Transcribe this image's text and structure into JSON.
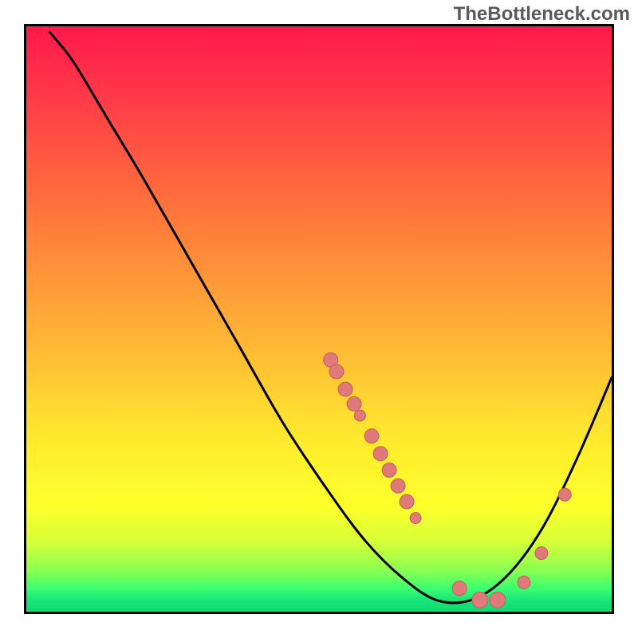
{
  "watermark": "TheBottleneck.com",
  "chart_data": {
    "type": "line",
    "title": "",
    "xlabel": "",
    "ylabel": "",
    "xlim": [
      0,
      100
    ],
    "ylim": [
      0,
      100
    ],
    "grid": false,
    "series": [
      {
        "name": "curve",
        "points": [
          {
            "x": 4,
            "y": 99
          },
          {
            "x": 8,
            "y": 94
          },
          {
            "x": 14,
            "y": 84
          },
          {
            "x": 20,
            "y": 74
          },
          {
            "x": 28,
            "y": 60
          },
          {
            "x": 36,
            "y": 46
          },
          {
            "x": 44,
            "y": 32
          },
          {
            "x": 52,
            "y": 20
          },
          {
            "x": 58,
            "y": 12
          },
          {
            "x": 64,
            "y": 6
          },
          {
            "x": 70,
            "y": 2
          },
          {
            "x": 76,
            "y": 2
          },
          {
            "x": 82,
            "y": 6
          },
          {
            "x": 88,
            "y": 14
          },
          {
            "x": 94,
            "y": 26
          },
          {
            "x": 100,
            "y": 40
          }
        ]
      }
    ],
    "markers": [
      {
        "x": 52,
        "y": 43,
        "r": 9
      },
      {
        "x": 53,
        "y": 41,
        "r": 9
      },
      {
        "x": 54.5,
        "y": 38,
        "r": 9
      },
      {
        "x": 56,
        "y": 35.5,
        "r": 9
      },
      {
        "x": 57,
        "y": 33.5,
        "r": 7
      },
      {
        "x": 59,
        "y": 30,
        "r": 9
      },
      {
        "x": 60.5,
        "y": 27,
        "r": 9
      },
      {
        "x": 62,
        "y": 24.2,
        "r": 9
      },
      {
        "x": 63.5,
        "y": 21.5,
        "r": 9
      },
      {
        "x": 65,
        "y": 18.8,
        "r": 9
      },
      {
        "x": 66.5,
        "y": 16,
        "r": 7
      },
      {
        "x": 74,
        "y": 4,
        "r": 9
      },
      {
        "x": 77.5,
        "y": 2,
        "r": 10
      },
      {
        "x": 80.5,
        "y": 2,
        "r": 10
      },
      {
        "x": 85,
        "y": 5,
        "r": 8
      },
      {
        "x": 88,
        "y": 10,
        "r": 8
      },
      {
        "x": 92,
        "y": 20,
        "r": 8
      }
    ],
    "background": {
      "type": "vertical-gradient",
      "stops": [
        {
          "pos": 0,
          "color": "#ff1a4a"
        },
        {
          "pos": 50,
          "color": "#ffb834"
        },
        {
          "pos": 80,
          "color": "#fff82c"
        },
        {
          "pos": 100,
          "color": "#18e678"
        }
      ]
    }
  }
}
